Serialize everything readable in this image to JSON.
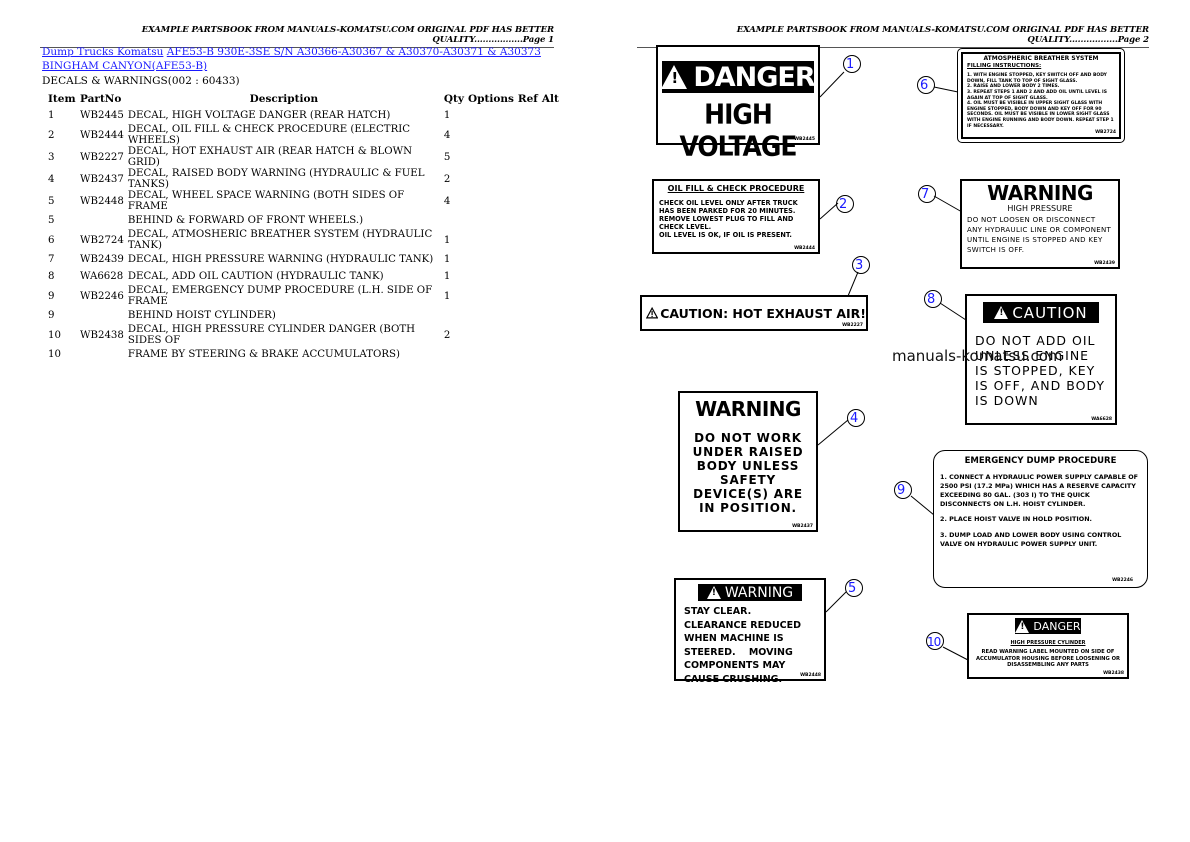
{
  "page1": {
    "header": "EXAMPLE PARTSBOOK FROM MANUALS-KOMATSU.COM ORIGINAL PDF HAS BETTER QUALITY.................Page 1",
    "breadcrumb": {
      "link1": "Dump Trucks Komatsu",
      "link2": "AFE53-B 930E-3SE S/N A30366-A30367 & A30370-A30371 & A30373",
      "link3": "BINGHAM CANYON(AFE53-B)"
    },
    "section_title": "DECALS & WARNINGS(002 : 60433)",
    "table": {
      "headers": [
        "Item",
        "PartNo",
        "Description",
        "Qty",
        "Options",
        "Ref",
        "Alt"
      ],
      "rows": [
        {
          "item": "1",
          "part": "WB2445",
          "desc": "DECAL, HIGH VOLTAGE DANGER (REAR HATCH)",
          "qty": "1"
        },
        {
          "item": "2",
          "part": "WB2444",
          "desc": "DECAL, OIL FILL & CHECK PROCEDURE (ELECTRIC WHEELS)",
          "qty": "4"
        },
        {
          "item": "3",
          "part": "WB2227",
          "desc": "DECAL, HOT EXHAUST AIR (REAR HATCH & BLOWN GRID)",
          "qty": "5"
        },
        {
          "item": "4",
          "part": "WB2437",
          "desc": "DECAL, RAISED BODY WARNING (HYDRAULIC & FUEL TANKS)",
          "qty": "2"
        },
        {
          "item": "5",
          "part": "WB2448",
          "desc": "DECAL, WHEEL SPACE WARNING (BOTH SIDES OF FRAME",
          "qty": "4"
        },
        {
          "item": "5",
          "part": "",
          "desc": "BEHIND & FORWARD OF FRONT WHEELS.)",
          "qty": ""
        },
        {
          "item": "6",
          "part": "WB2724",
          "desc": "DECAL, ATMOSHERIC BREATHER SYSTEM (HYDRAULIC TANK)",
          "qty": "1"
        },
        {
          "item": "7",
          "part": "WB2439",
          "desc": "DECAL, HIGH PRESSURE WARNING (HYDRAULIC TANK)",
          "qty": "1"
        },
        {
          "item": "8",
          "part": "WA6628",
          "desc": "DECAL, ADD OIL CAUTION (HYDRAULIC TANK)",
          "qty": "1"
        },
        {
          "item": "9",
          "part": "WB2246",
          "desc": "DECAL, EMERGENCY DUMP PROCEDURE (L.H. SIDE OF FRAME",
          "qty": "1"
        },
        {
          "item": "9",
          "part": "",
          "desc": "BEHIND HOIST CYLINDER)",
          "qty": ""
        },
        {
          "item": "10",
          "part": "WB2438",
          "desc": "DECAL, HIGH PRESSURE CYLINDER DANGER (BOTH SIDES OF",
          "qty": "2"
        },
        {
          "item": "10",
          "part": "",
          "desc": "FRAME BY STEERING & BRAKE ACCUMULATORS)",
          "qty": ""
        }
      ]
    }
  },
  "page2": {
    "header": "EXAMPLE PARTSBOOK FROM MANUALS-KOMATSU.COM ORIGINAL PDF HAS BETTER QUALITY.................Page 2",
    "watermark": "manuals-komatsu.com",
    "decals": {
      "d1": {
        "callout": "1",
        "title": "DANGER",
        "body": "HIGH VOLTAGE",
        "code": "WB2445"
      },
      "d2": {
        "callout": "2",
        "title": "OIL FILL & CHECK PROCEDURE",
        "body": "CHECK OIL LEVEL ONLY AFTER TRUCK HAS BEEN PARKED FOR 20 MINUTES. REMOVE LOWEST PLUG TO FILL AND CHECK LEVEL.",
        "body2": "OIL LEVEL IS OK, IF OIL IS PRESENT.",
        "code": "WB2444"
      },
      "d3": {
        "callout": "3",
        "title": "CAUTION: HOT EXHAUST AIR!",
        "code": "WB2227"
      },
      "d4": {
        "callout": "4",
        "title": "WARNING",
        "body": "DO NOT WORK UNDER RAISED BODY UNLESS SAFETY DEVICE(S) ARE IN POSITION.",
        "code": "WB2437"
      },
      "d5": {
        "callout": "5",
        "title": "WARNING",
        "body": "STAY CLEAR. CLEARANCE REDUCED WHEN MACHINE IS STEERED.    MOVING COMPONENTS MAY CAUSE CRUSHING.",
        "code": "WB2448"
      },
      "d6": {
        "callout": "6",
        "title": "ATMOSPHERIC BREATHER SYSTEM",
        "subtitle": "FILLING INSTRUCTIONS:",
        "steps": [
          "1. WITH ENGINE STOPPED, KEY SWITCH OFF AND BODY DOWN, FILL TANK TO TOP OF SIGHT GLASS.",
          "2. RAISE AND LOWER BODY 2 TIMES.",
          "3. REPEAT STEPS 1 AND 2 AND ADD OIL UNTIL LEVEL IS AGAIN AT TOP OF SIGHT GLASS.",
          "4. OIL MUST BE VISIBLE IN UPPER SIGHT GLASS WITH ENGINE STOPPED, BODY DOWN AND KEY OFF FOR 90 SECONDS. OIL MUST BE VISIBLE IN LOWER SIGHT GLASS WITH ENGINE RUNNING AND BODY DOWN. REPEAT STEP 1 IF NECESSARY."
        ],
        "code": "WB2724"
      },
      "d7": {
        "callout": "7",
        "title": "WARNING",
        "subtitle": "HIGH PRESSURE",
        "body": "DO NOT LOOSEN OR DISCONNECT ANY HYDRAULIC LINE OR COMPONENT UNTIL ENGINE IS STOPPED AND KEY SWITCH IS OFF.",
        "code": "WB2439"
      },
      "d8": {
        "callout": "8",
        "title": "CAUTION",
        "body": "DO NOT ADD OIL UNLESS ENGINE IS STOPPED, KEY IS OFF, AND BODY IS DOWN",
        "code": "WA6628"
      },
      "d9": {
        "callout": "9",
        "title": "EMERGENCY DUMP PROCEDURE",
        "steps": [
          "1. CONNECT A HYDRAULIC POWER SUPPLY CAPABLE OF 2500 PSI (17.2 MPa) WHICH HAS A RESERVE CAPACITY EXCEEDING 80 GAL. (303 l) TO THE QUICK DISCONNECTS ON L.H. HOIST CYLINDER.",
          "2. PLACE HOIST VALVE IN HOLD POSITION.",
          "3. DUMP LOAD AND LOWER BODY USING CONTROL VALVE ON HYDRAULIC POWER SUPPLY UNIT."
        ],
        "code": "WB2246"
      },
      "d10": {
        "callout": "10",
        "title": "DANGER",
        "subtitle": "HIGH PRESSURE CYLINDER",
        "body": "READ WARNING LABEL MOUNTED ON SIDE OF ACCUMULATOR HOUSING BEFORE LOOSENING OR DISASSEMBLING ANY PARTS",
        "code": "WB2438"
      }
    }
  }
}
